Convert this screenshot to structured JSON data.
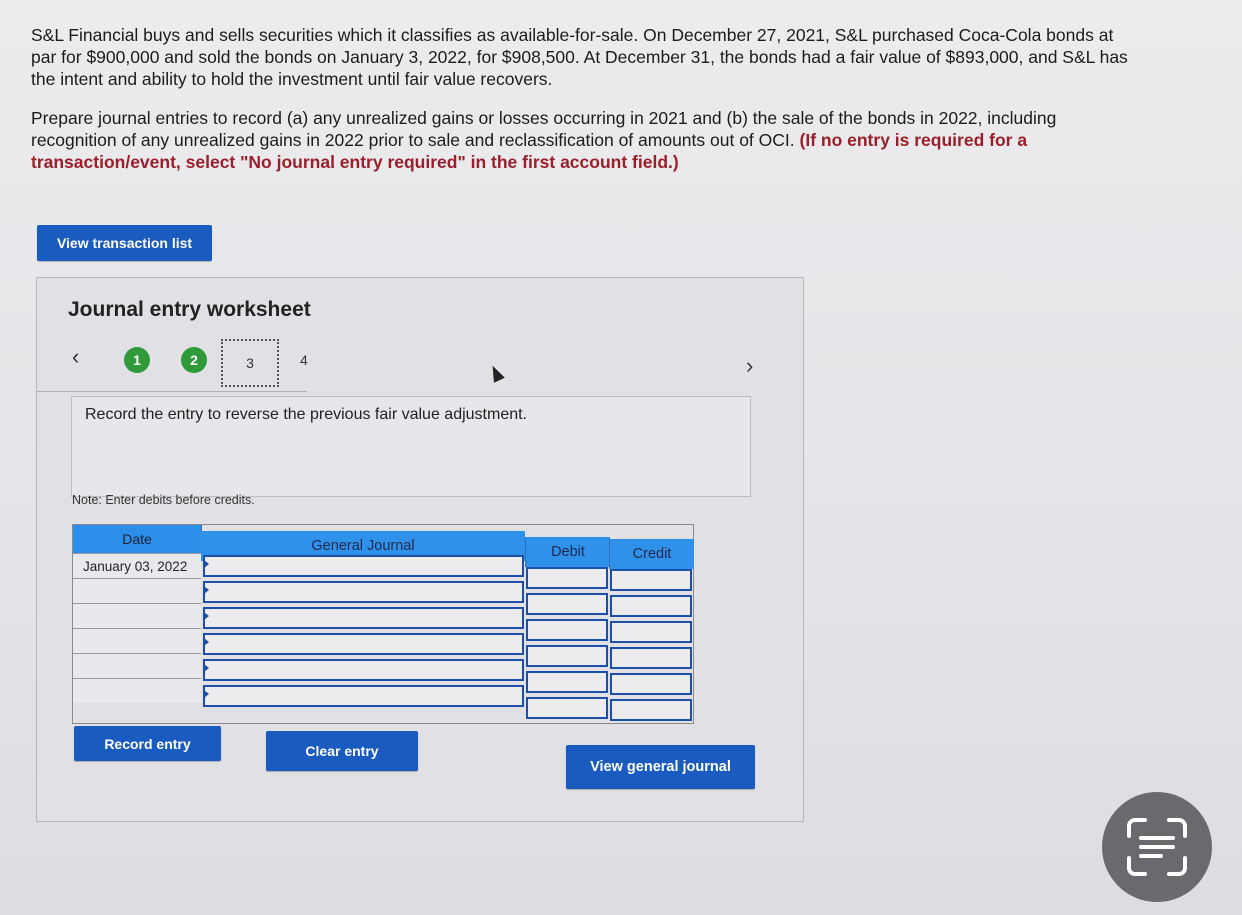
{
  "problem": {
    "paragraph1": "S&L Financial buys and sells securities which it classifies as available-for-sale. On December 27, 2021, S&L purchased Coca-Cola bonds at par for $900,000 and sold the bonds on January 3, 2022, for $908,500. At December 31, the bonds had a fair value of $893,000, and S&L has the intent and ability to hold the investment until fair value recovers.",
    "paragraph2": "Prepare journal entries to record (a) any unrealized gains or losses occurring in 2021 and (b) the sale of the bonds in 2022, including recognition of any unrealized gains in 2022 prior to sale and reclassification of amounts out of OCI.",
    "instruction": "(If no entry is required for a transaction/event, select \"No journal entry required\" in the first account field.)"
  },
  "buttons": {
    "view_transaction_list": "View transaction list",
    "record_entry": "Record entry",
    "clear_entry": "Clear entry",
    "view_general_journal": "View general journal"
  },
  "worksheet": {
    "title": "Journal entry worksheet",
    "steps": [
      "1",
      "2",
      "3",
      "4"
    ],
    "current_step": "3",
    "prompt": "Record the entry to reverse the previous fair value adjustment.",
    "note": "Note: Enter debits before credits."
  },
  "table": {
    "headers": {
      "date": "Date",
      "general_journal": "General Journal",
      "debit": "Debit",
      "credit": "Credit"
    },
    "rows": [
      {
        "date": "January 03, 2022",
        "account": "",
        "debit": "",
        "credit": ""
      },
      {
        "date": "",
        "account": "",
        "debit": "",
        "credit": ""
      },
      {
        "date": "",
        "account": "",
        "debit": "",
        "credit": ""
      },
      {
        "date": "",
        "account": "",
        "debit": "",
        "credit": ""
      },
      {
        "date": "",
        "account": "",
        "debit": "",
        "credit": ""
      },
      {
        "date": "",
        "account": "",
        "debit": "",
        "credit": ""
      }
    ]
  },
  "icons": {
    "prev": "chevron-left-icon",
    "next": "chevron-right-icon",
    "scan": "scan-text-icon"
  },
  "colors": {
    "button_blue": "#1a5bbf",
    "header_blue": "#2f91ea",
    "step_done_green": "#2e9a3a",
    "instruction_red": "#9a1f2a"
  }
}
